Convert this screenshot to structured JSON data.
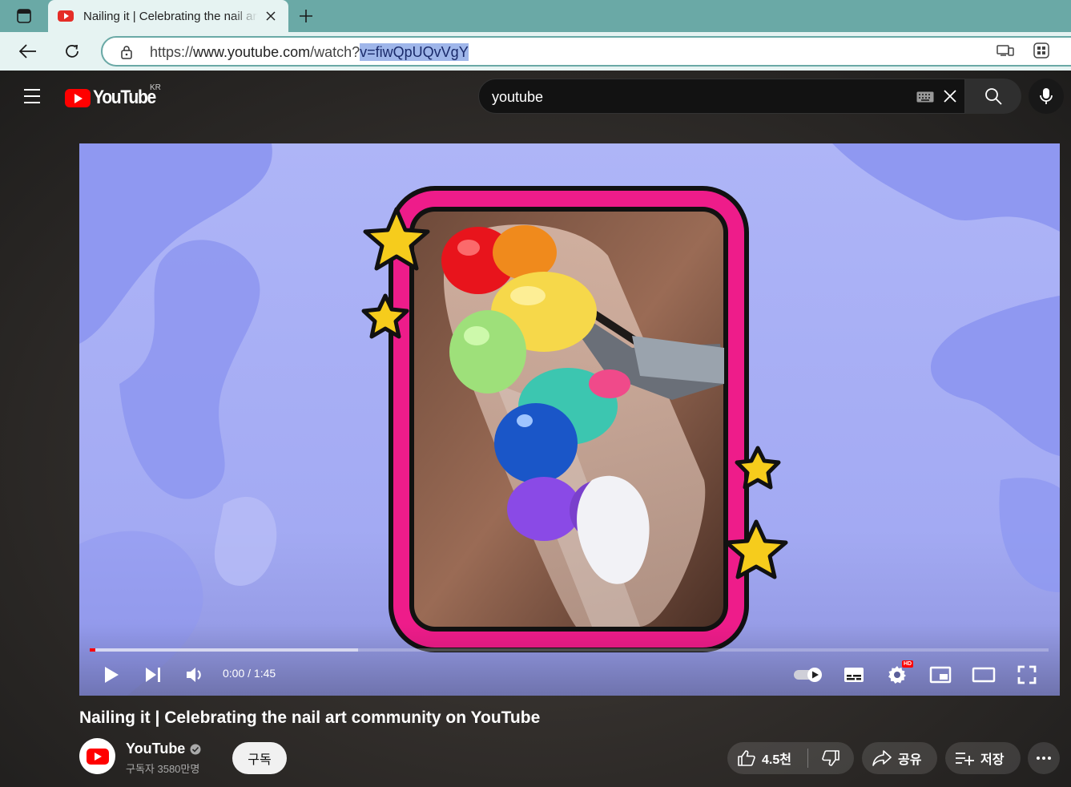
{
  "browser": {
    "tab_title": "Nailing it | Celebrating the nail art community on YouTube",
    "url_scheme": "https://",
    "url_host": "www.youtube.com",
    "url_path": "/watch?",
    "url_selected": "v=fiwQpUQvVgY"
  },
  "header": {
    "logo_text": "YouTube",
    "region": "KR",
    "search_value": "youtube"
  },
  "player": {
    "time": "0:00 / 1:45",
    "hd_badge": "HD",
    "progress_played": 0.006,
    "progress_buffered": 0.28
  },
  "video": {
    "title": "Nailing it | Celebrating the nail art community on YouTube",
    "channel": "YouTube",
    "subscribers": "구독자 3580만명",
    "subscribe_label": "구독",
    "likes": "4.5천",
    "share_label": "공유",
    "save_label": "저장"
  },
  "colors": {
    "tabbar": "#6aa9a6",
    "accent_red": "#ff0000",
    "frame_pink": "#ee1c8a",
    "video_bg": "#a9b1f5"
  }
}
